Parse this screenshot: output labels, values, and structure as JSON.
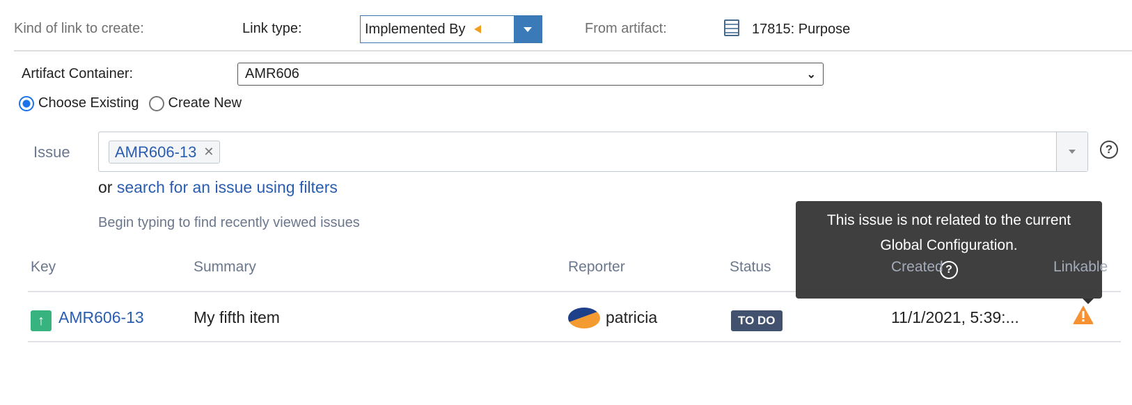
{
  "toolbar": {
    "kind_label": "Kind of link to create:",
    "link_type_label": "Link type:",
    "link_type_value": "Implemented By",
    "from_artifact_label": "From artifact:",
    "from_artifact_value": "17815: Purpose"
  },
  "container": {
    "label": "Artifact Container:",
    "value": "AMR606"
  },
  "mode": {
    "choose_existing": "Choose Existing",
    "create_new": "Create New",
    "selected": "choose_existing"
  },
  "issue": {
    "label": "Issue",
    "tag": "AMR606-13",
    "or_text": "or",
    "search_link": "search for an issue using filters",
    "hint": "Begin typing to find recently viewed issues"
  },
  "table": {
    "headers": [
      "Key",
      "Summary",
      "Reporter",
      "Status",
      "Created",
      "Linkable"
    ],
    "rows": [
      {
        "key": "AMR606-13",
        "summary": "My fifth item",
        "reporter": "patricia",
        "status": "TO DO",
        "created": "11/1/2021, 5:39:...",
        "linkable_icon": "warning-icon"
      }
    ]
  },
  "tooltip": {
    "line1": "This issue is not related to the current",
    "line2": "Global Configuration.",
    "icon": "help-icon"
  },
  "colors": {
    "accent": "#3a7ab8",
    "link": "#2a5db0",
    "status_todo": "#42526e",
    "warning": "#f79232",
    "issue_type": "#36b37e"
  }
}
